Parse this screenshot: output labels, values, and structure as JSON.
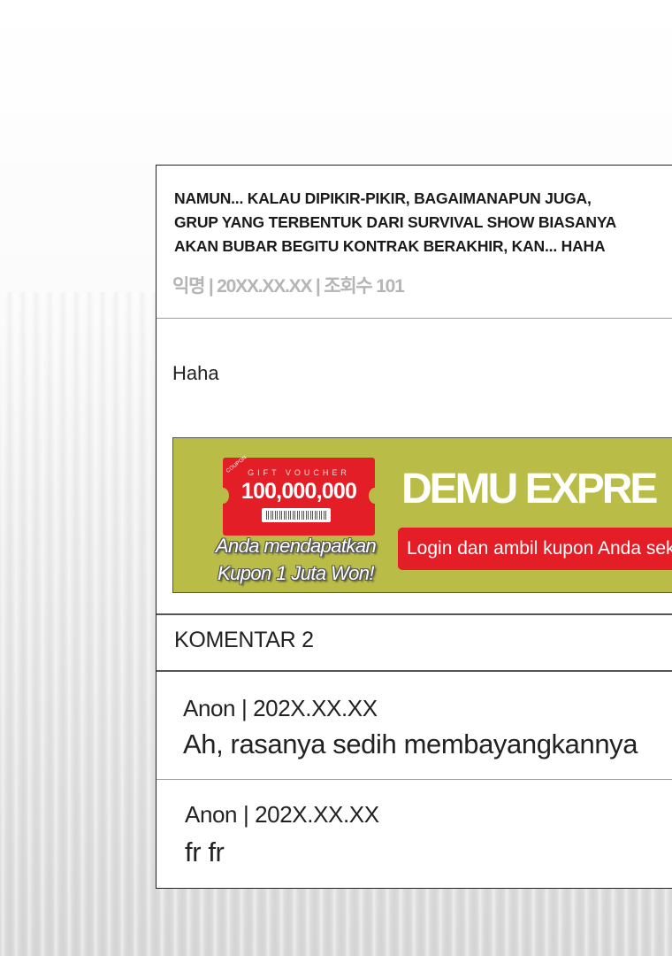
{
  "post": {
    "title": "NAMUN... KALAU DIPIKIR-PIKIR, BAGAIMANAPUN JUGA,\nGRUP YANG TERBENTUK DARI SURVIVAL SHOW BIASANYA\nAKAN BUBAR BEGITU KONTRAK BERAKHIR, KAN... HAHA",
    "meta": "익명 | 20XX.XX.XX | 조회수 101",
    "body": "Haha"
  },
  "ad": {
    "coupon_tag": "COUPON",
    "voucher_label": "GIFT VOUCHER",
    "amount": "100,000,000",
    "caption_line1": "Anda mendapatkan",
    "caption_line2": "Kupon 1 Juta Won!",
    "brand": "DEMU EXPRE",
    "cta": "Login dan ambil kupon Anda sek",
    "colors": {
      "background": "#b9bd47",
      "accent": "#e41e26"
    }
  },
  "comments": {
    "header": "KOMENTAR 2",
    "items": [
      {
        "author": "Anon | 202X.XX.XX",
        "text": "Ah, rasanya sedih membayangkannya"
      },
      {
        "author": "Anon | 202X.XX.XX",
        "text": "fr fr"
      }
    ]
  }
}
